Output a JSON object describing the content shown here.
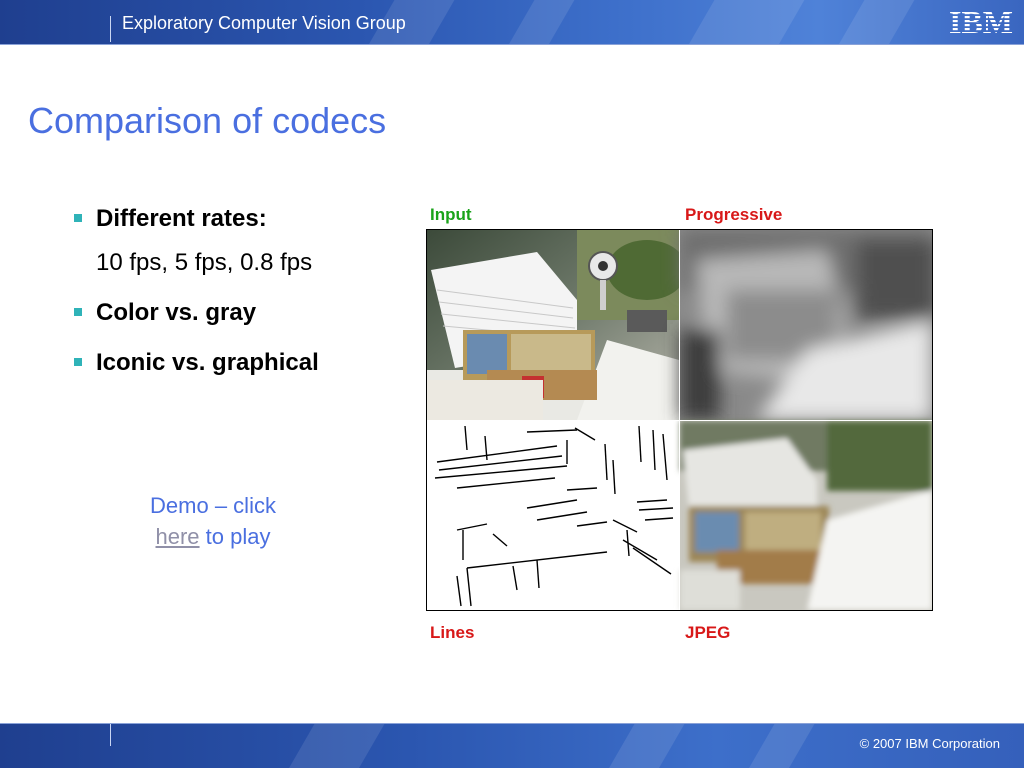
{
  "header": {
    "group_title": "Exploratory Computer Vision Group",
    "logo_text": "IBM",
    "brand_color": "#2b56b0"
  },
  "slide": {
    "title": "Comparison of codecs",
    "bullets": [
      {
        "label": "Different rates:",
        "sub": "10 fps, 5 fps, 0.8 fps"
      },
      {
        "label": "Color vs. gray"
      },
      {
        "label": "Iconic vs. graphical"
      }
    ],
    "demo": {
      "prefix": "Demo – click",
      "link": "here",
      "suffix": " to play"
    }
  },
  "panels": {
    "input": "Input",
    "progressive": "Progressive",
    "lines": "Lines",
    "jpeg": "JPEG"
  },
  "footer": {
    "copyright": "© 2007 IBM Corporation"
  }
}
